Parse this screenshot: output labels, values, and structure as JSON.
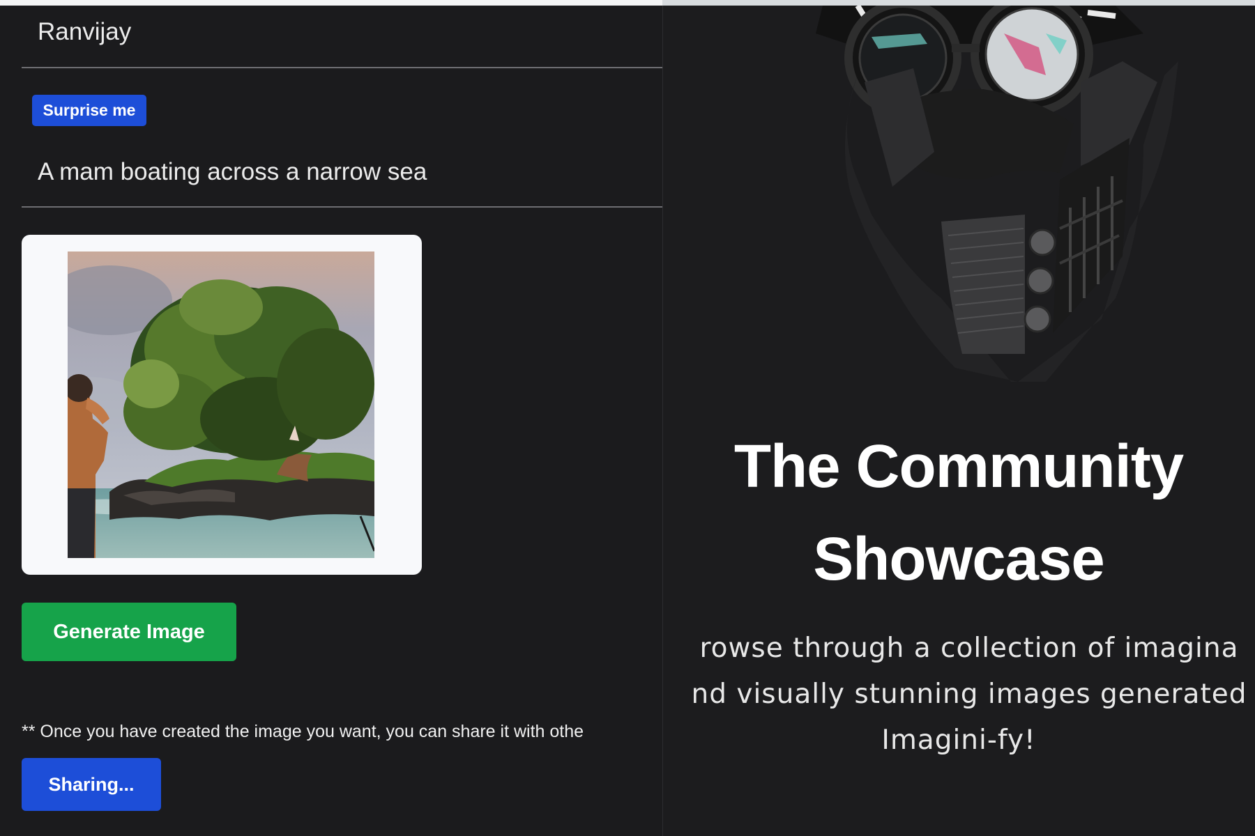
{
  "form": {
    "name_value": "Ranvijay",
    "surprise_label": "Surprise me",
    "prompt_value": "A mam boating across a narrow sea",
    "generate_label": "Generate Image",
    "share_note": "** Once you have created the image you want, you can share it with othe",
    "sharing_label": "Sharing..."
  },
  "hero": {
    "title_line1": "The Community",
    "title_line2": "Showcase",
    "desc_line1": "rowse through a collection of imagina",
    "desc_line2": "nd visually stunning images generated",
    "desc_line3": "Imagini-fy!"
  },
  "colors": {
    "background": "#1b1b1d",
    "primary_blue": "#1d4ed8",
    "generate_green": "#16a34a",
    "card_bg": "#f8f9fb"
  }
}
